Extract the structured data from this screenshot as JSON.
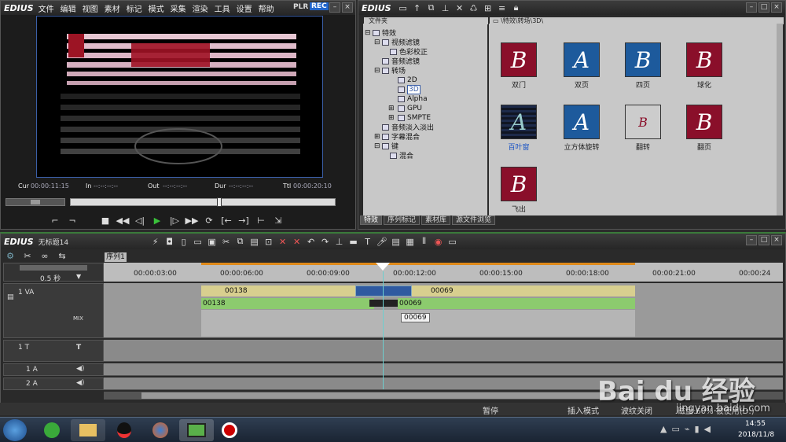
{
  "player": {
    "logo": "EDIUS",
    "menu": [
      "文件",
      "编辑",
      "视图",
      "素材",
      "标记",
      "模式",
      "采集",
      "渲染",
      "工具",
      "设置",
      "帮助"
    ],
    "mode_plr": "PLR",
    "mode_rec": "REC",
    "timecodes": {
      "cur_label": "Cur",
      "cur": "00:00:11:15",
      "in_label": "In",
      "in": "--:--:--:--",
      "out_label": "Out",
      "out": "--:--:--:--",
      "dur_label": "Dur",
      "dur": "--:--:--:--",
      "ttl_label": "Ttl",
      "ttl": "00:00:20:10"
    }
  },
  "palette": {
    "logo": "EDIUS",
    "tree_header": "文件夹",
    "path": "\\特效\\转场\\3D\\",
    "tree": [
      {
        "label": "特效",
        "indent": 0,
        "expander": "⊟"
      },
      {
        "label": "视频滤镜",
        "indent": 1,
        "expander": "⊟"
      },
      {
        "label": "色彩校正",
        "indent": 2,
        "expander": ""
      },
      {
        "label": "音频滤镜",
        "indent": 1,
        "expander": ""
      },
      {
        "label": "转场",
        "indent": 1,
        "expander": "⊟"
      },
      {
        "label": "2D",
        "indent": 2,
        "expander": ""
      },
      {
        "label": "3D",
        "indent": 2,
        "expander": "",
        "selected": true
      },
      {
        "label": "Alpha",
        "indent": 2,
        "expander": ""
      },
      {
        "label": "GPU",
        "indent": 2,
        "expander": "⊞"
      },
      {
        "label": "SMPTE",
        "indent": 2,
        "expander": "⊞"
      },
      {
        "label": "音频淡入淡出",
        "indent": 1,
        "expander": ""
      },
      {
        "label": "字幕混合",
        "indent": 1,
        "expander": "⊞"
      },
      {
        "label": "键",
        "indent": 1,
        "expander": "⊟"
      },
      {
        "label": "混合",
        "indent": 2,
        "expander": ""
      }
    ],
    "effects": [
      {
        "label": "双门",
        "glyph": "B"
      },
      {
        "label": "双页",
        "glyph": "A"
      },
      {
        "label": "四页",
        "glyph": "B"
      },
      {
        "label": "球化",
        "glyph": "B"
      },
      {
        "label": "百叶窗",
        "glyph": "A"
      },
      {
        "label": "立方体旋转",
        "glyph": "A"
      },
      {
        "label": "翻转",
        "glyph": "B"
      },
      {
        "label": "翻页",
        "glyph": "B"
      },
      {
        "label": "飞出",
        "glyph": "B"
      }
    ],
    "tabs": [
      "特效",
      "序列标记",
      "素材库",
      "源文件浏览"
    ]
  },
  "timeline": {
    "logo": "EDIUS",
    "project_name": "无标题14",
    "sequence_tab": "序列1",
    "zoom": "0.5 秒",
    "ruler": [
      "00:00:03:00",
      "00:00:06:00",
      "00:00:09:00",
      "00:00:12:00",
      "00:00:15:00",
      "00:00:18:00",
      "00:00:21:00",
      "00:00:24"
    ],
    "tracks": {
      "va": "1 VA",
      "mix": "MIX",
      "t": "1 T",
      "a1": "1 A",
      "a2": "2 A"
    },
    "clips": {
      "v_left": "00138",
      "v_right": "00069",
      "a_left": "00138",
      "a_right": "00069",
      "tooltip": "00069"
    }
  },
  "status": {
    "pause": "暂停",
    "insert": "插入模式",
    "ripple": "波纹关闭",
    "disk": "磁盘:60% 被使用(D:)"
  },
  "taskbar": {
    "time": "14:55",
    "date": "2018/11/8"
  },
  "watermark": {
    "text": "Bai du 经验",
    "url": "jingyan.baidu.com"
  }
}
